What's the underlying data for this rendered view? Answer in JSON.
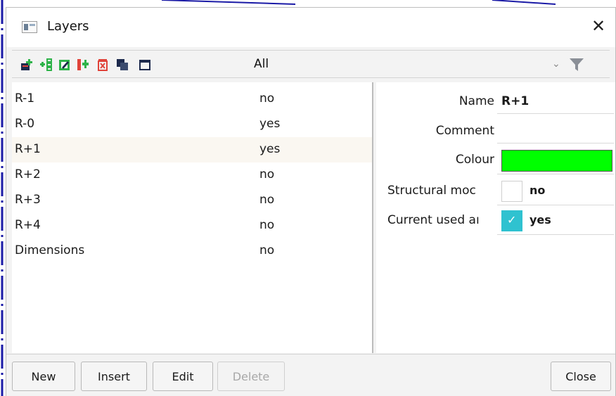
{
  "window": {
    "title": "Layers",
    "close_glyph": "✕",
    "icon": "window-icon"
  },
  "toolbar": {
    "icons": [
      "new-layer-icon",
      "insert-layer-icon",
      "edit-layer-icon",
      "copy-layer-icon",
      "delete-layer-icon",
      "duplicate-layer-icon",
      "select-all-icon"
    ],
    "filter_value": "All",
    "dropdown_glyph": "⌄",
    "filter_icon": "funnel-icon"
  },
  "layers": [
    {
      "name": "R-1",
      "value": "no"
    },
    {
      "name": "R-0",
      "value": "yes"
    },
    {
      "name": "R+1",
      "value": "yes"
    },
    {
      "name": "R+2",
      "value": "no"
    },
    {
      "name": "R+3",
      "value": "no"
    },
    {
      "name": "R+4",
      "value": "no"
    },
    {
      "name": "Dimensions",
      "value": "no"
    }
  ],
  "selected_layer": "R+1",
  "properties": {
    "name_label": "Name",
    "name_value": "R+1",
    "comment_label": "Comment",
    "comment_value": "",
    "colour_label": "Colour",
    "colour_value": "#00ff00",
    "structural_label": "Structural moc",
    "structural_value": "no",
    "structural_checked": false,
    "current_label": "Current used aı",
    "current_value": "yes",
    "current_checked": true
  },
  "buttons": {
    "new": "New",
    "insert": "Insert",
    "edit": "Edit",
    "delete": "Delete",
    "close": "Close"
  },
  "colors": {
    "accent_check": "#2fc2d0",
    "icon_green": "#2fb34a",
    "icon_red": "#e0433a",
    "icon_navy": "#1d2a4d",
    "filter_gray": "#8a8f97"
  }
}
